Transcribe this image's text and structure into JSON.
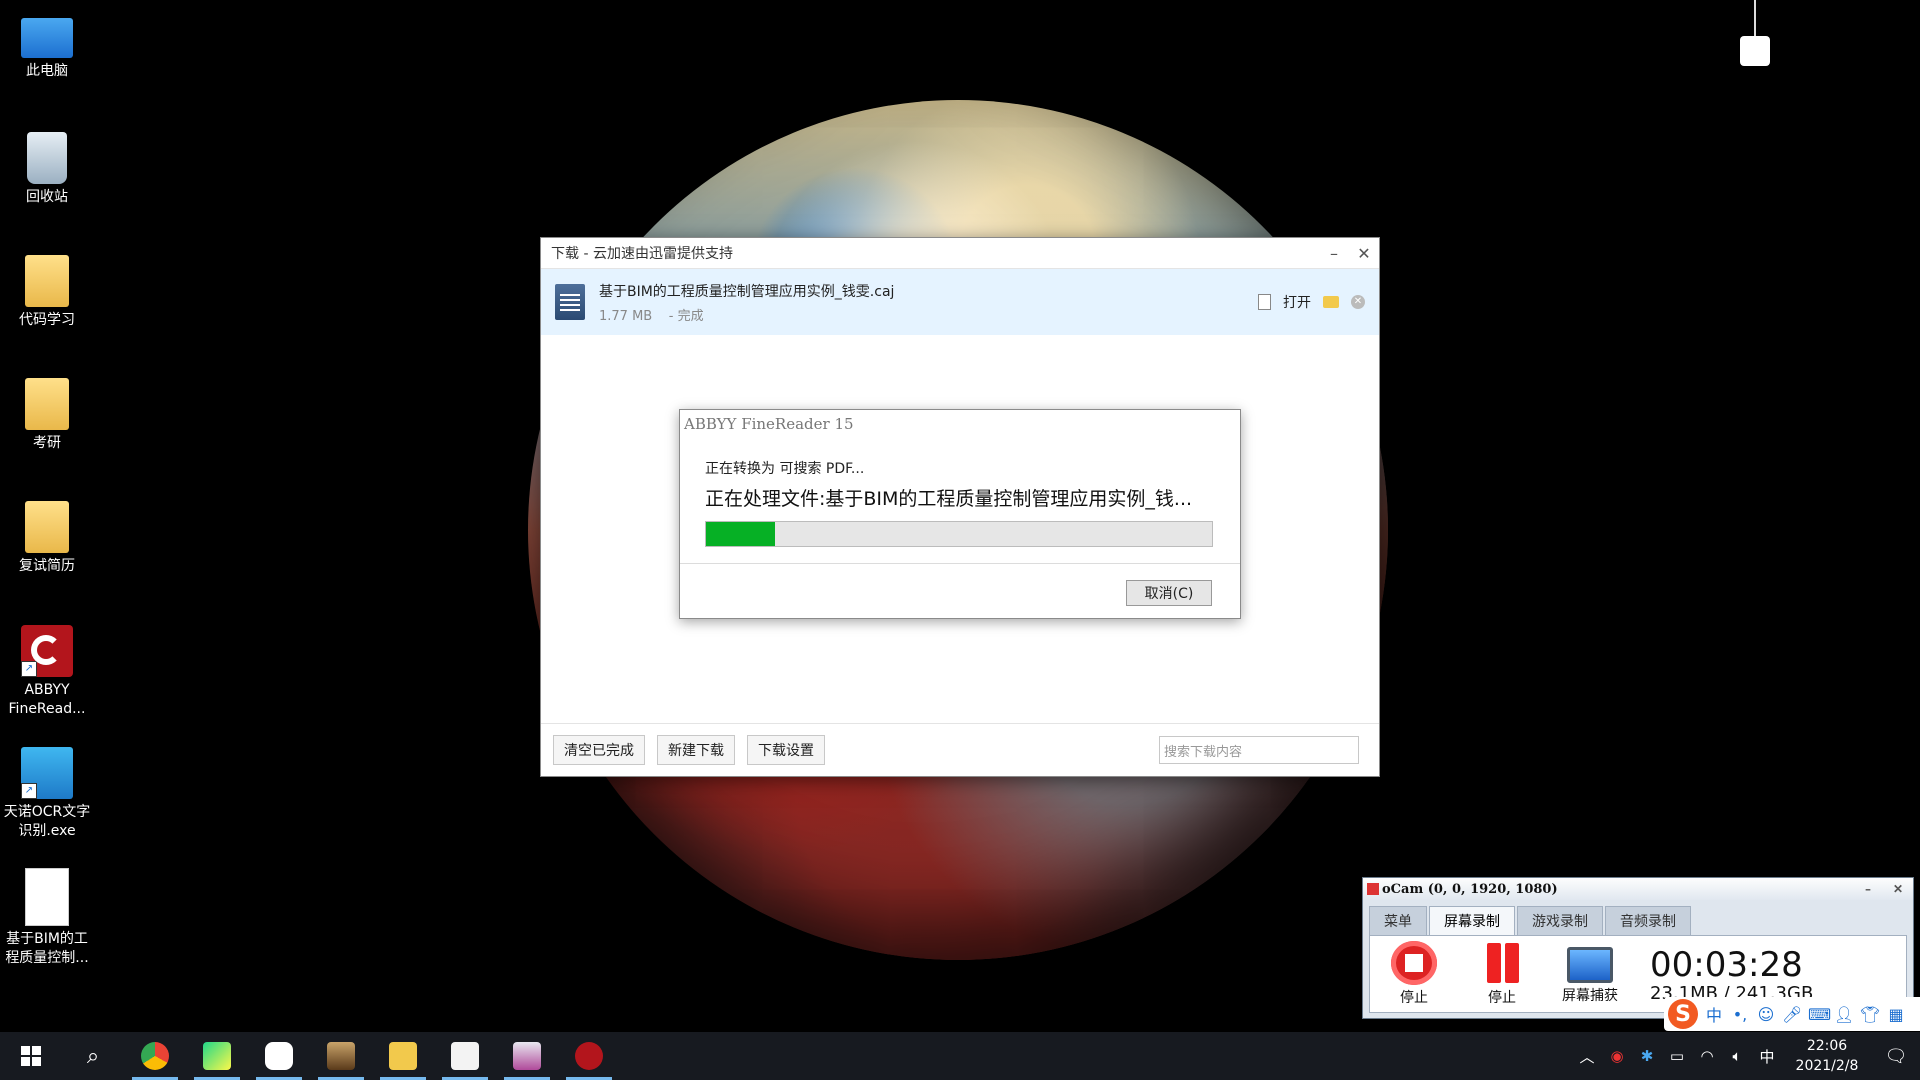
{
  "desktop": {
    "icons": [
      {
        "label": "此电脑"
      },
      {
        "label": "回收站"
      },
      {
        "label": "代码学习"
      },
      {
        "label": "考研"
      },
      {
        "label": "复试简历"
      },
      {
        "label": "ABBYY FineRead..."
      },
      {
        "label": "天诺OCR文字识别.exe"
      },
      {
        "label": "基于BIM的工程质量控制..."
      }
    ]
  },
  "download_window": {
    "title": "下载 - 云加速由迅雷提供支持",
    "item": {
      "filename": "基于BIM的工程质量控制管理应用实例_钱雯.caj",
      "size": "1.77 MB",
      "status": "- 完成",
      "open_label": "打开"
    },
    "footer": {
      "clear_label": "清空已完成",
      "new_label": "新建下载",
      "settings_label": "下载设置",
      "search_placeholder": "搜索下载内容"
    }
  },
  "abbyy_dialog": {
    "title": "ABBYY FineReader 15",
    "line1": "正在转换为 可搜索 PDF...",
    "line2": "正在处理文件:基于BIM的工程质量控制管理应用实例_钱...",
    "progress": 0.137,
    "cancel_label": "取消(C)"
  },
  "ocam": {
    "title": "oCam (0, 0, 1920, 1080)",
    "tabs": [
      "菜单",
      "屏幕录制",
      "游戏录制",
      "音频录制"
    ],
    "active_tab": "屏幕录制",
    "buttons": [
      "停止",
      "停止",
      "屏幕捕获"
    ],
    "time": "00:03:28",
    "size": "23.1MB / 241.3GB"
  },
  "ime": {
    "mode": "中"
  },
  "taskbar": {
    "tray_lang": "中",
    "time": "22:06",
    "date": "2021/2/8"
  },
  "colors": {
    "progress_fill": "#06b025",
    "item_highlight": "#e5f3ff",
    "taskbar": "#171a20"
  }
}
